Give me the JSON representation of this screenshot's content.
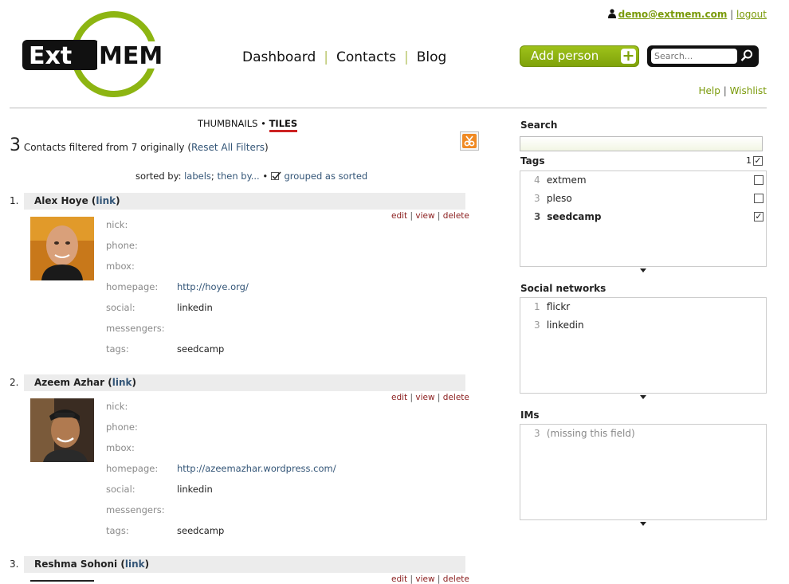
{
  "header": {
    "user_email": "demo@extmem.com",
    "logout_label": "logout",
    "separator": "|",
    "nav": [
      "Dashboard",
      "Contacts",
      "Blog"
    ],
    "add_button_label": "Add person",
    "search_placeholder": "Search...",
    "help_label": "Help",
    "wishlist_label": "Wishlist"
  },
  "logo": {
    "text_left": "Ext",
    "text_right": "MEM",
    "accent_color": "#8db512"
  },
  "list": {
    "view_thumbnails": "THUMBNAILS",
    "view_dot": "•",
    "view_tiles": "TILES",
    "count": "3",
    "count_text": "Contacts filtered from 7 originally (",
    "reset_label": "Reset All Filters",
    "count_close": ")",
    "sorted_prefix": "sorted by:",
    "sort_labels": "labels",
    "sort_then": "then by...",
    "grouped_label": "grouped as sorted",
    "action_edit": "edit",
    "action_view": "view",
    "action_delete": "delete",
    "field_labels": [
      "nick:",
      "phone:",
      "mbox:",
      "homepage:",
      "social:",
      "messengers:",
      "tags:"
    ],
    "contacts": [
      {
        "num": "1.",
        "name": "Alex Hoye",
        "link": "link",
        "homepage": "http://hoye.org/",
        "social": "linkedin",
        "tags": "seedcamp"
      },
      {
        "num": "2.",
        "name": "Azeem Azhar",
        "link": "link",
        "homepage": "http://azeemazhar.wordpress.com/",
        "social": "linkedin",
        "tags": "seedcamp"
      },
      {
        "num": "3.",
        "name": "Reshma Sohoni",
        "link": "link"
      }
    ]
  },
  "sidebar": {
    "search_title": "Search",
    "tags_title": "Tags",
    "tags_selected_count": "1",
    "tags": [
      {
        "count": "4",
        "name": "extmem",
        "checked": false
      },
      {
        "count": "3",
        "name": "pleso",
        "checked": false
      },
      {
        "count": "3",
        "name": "seedcamp",
        "checked": true
      }
    ],
    "social_title": "Social networks",
    "social": [
      {
        "count": "1",
        "name": "flickr"
      },
      {
        "count": "3",
        "name": "linkedin"
      }
    ],
    "ims_title": "IMs",
    "ims": [
      {
        "count": "3",
        "name": "(missing this field)"
      }
    ]
  }
}
